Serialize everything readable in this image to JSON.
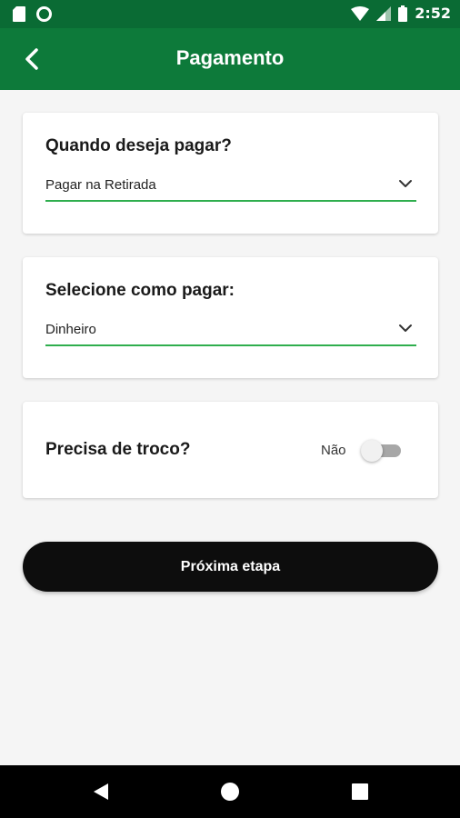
{
  "status_bar": {
    "time": "2:52",
    "left_icons": [
      "sd-card-icon",
      "circle-notification-icon"
    ],
    "right_icons": [
      "wifi-icon",
      "signal-icon",
      "battery-icon"
    ]
  },
  "header": {
    "title": "Pagamento",
    "back_icon": "chevron-left-icon"
  },
  "when_to_pay": {
    "label": "Quando deseja pagar?",
    "selected": "Pagar na Retirada"
  },
  "how_to_pay": {
    "label": "Selecione como pagar:",
    "selected": "Dinheiro"
  },
  "change": {
    "label": "Precisa de troco?",
    "state_label": "Não",
    "enabled": false
  },
  "actions": {
    "next_label": "Próxima etapa"
  },
  "colors": {
    "app_bar": "#0d7a3a",
    "status_bar": "#0a6b34",
    "underline": "#2fae4e",
    "button": "#0d0d0d"
  },
  "nav_bar": {
    "icons": [
      "back-triangle-icon",
      "home-circle-icon",
      "recents-square-icon"
    ]
  }
}
